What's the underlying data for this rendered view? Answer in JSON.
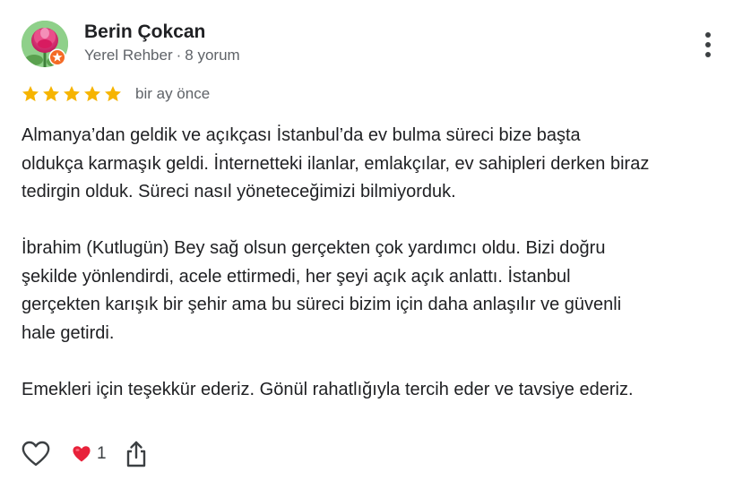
{
  "author": {
    "name": "Berin Çokcan",
    "role": "Yerel Rehber",
    "separator": "·",
    "review_count": "8 yorum",
    "avatar": "pink-rose-flower",
    "badge_icon": "local-guide-badge-icon"
  },
  "rating": {
    "stars": 5,
    "max": 5,
    "date": "bir ay önce",
    "star_color": "#f6b400"
  },
  "review": {
    "paragraphs": [
      "Almanya’dan geldik ve açıkçası İstanbul’da ev bulma süreci bize başta\noldukça karmaşık geldi. İnternetteki ilanlar, emlakçılar, ev sahipleri derken biraz\ntedirgin olduk. Süreci nasıl yöneteceğimizi bilmiyorduk.",
      "İbrahim (Kutlugün) Bey sağ olsun gerçekten çok yardımcı oldu. Bizi doğru\nşekilde yönlendirdi, acele ettirmedi, her şeyi açık açık anlattı. İstanbul\ngerçekten karışık bir şehir ama bu süreci bizim için daha anlaşılır ve güvenli\nhale getirdi.",
      "Emekleri için teşekkür ederiz. Gönül rahatlığıyla tercih eder ve tavsiye ederiz."
    ]
  },
  "actions": {
    "like_icon": "heart-outline-icon",
    "reaction_icon": "red-heart-icon",
    "reaction_count": "1",
    "share_icon": "share-icon",
    "more_icon": "more-vertical-icon"
  }
}
